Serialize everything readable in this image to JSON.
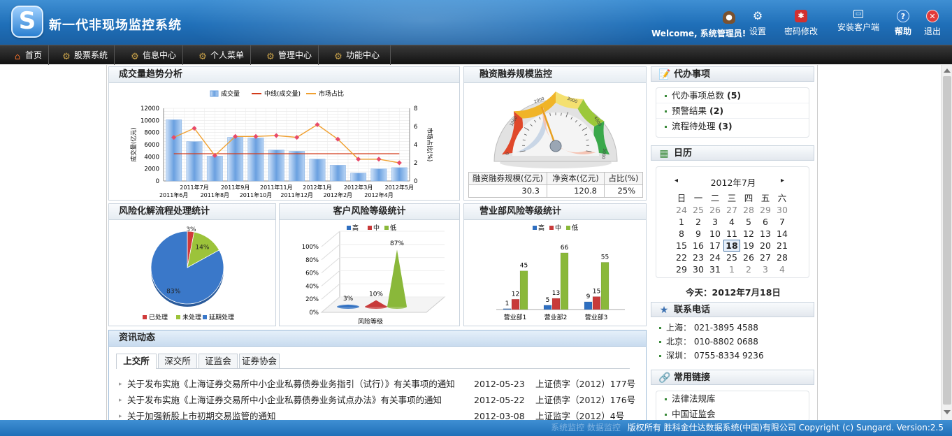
{
  "header": {
    "logo_letter": "S",
    "title": "新一代非现场监控系统",
    "welcome": "Welcome, 系统管理员!",
    "tools": [
      {
        "label": "设置",
        "icon": "gear-icon"
      },
      {
        "label": "密码修改",
        "icon": "key-icon"
      },
      {
        "label": "安装客户端",
        "icon": "install-icon"
      },
      {
        "label": "帮助",
        "icon": "help-icon"
      },
      {
        "label": "退出",
        "icon": "exit-icon"
      }
    ]
  },
  "menu": [
    {
      "label": "首页",
      "icon": "home-icon"
    },
    {
      "label": "股票系统",
      "icon": "gear-icon"
    },
    {
      "label": "信息中心",
      "icon": "gear-icon"
    },
    {
      "label": "个人菜单",
      "icon": "gear-icon"
    },
    {
      "label": "管理中心",
      "icon": "gear-icon"
    },
    {
      "label": "功能中心",
      "icon": "gear-icon"
    }
  ],
  "panels": {
    "trend": {
      "title": "成交量趋势分析"
    },
    "margin": {
      "title": "融资融券规模监控",
      "table_headers": [
        "融资融券规模(亿元)",
        "净资本(亿元)",
        "占比(%)"
      ],
      "table_values": [
        "30.3",
        "120.8",
        "25%"
      ]
    },
    "risk": {
      "title": "风险化解流程处理统计"
    },
    "customer_risk": {
      "title": "客户风险等级统计"
    },
    "branch_risk": {
      "title": "营业部风险等级统计"
    },
    "news": {
      "title": "资讯动态"
    }
  },
  "chart_data": [
    {
      "type": "bar",
      "title": "",
      "legend": [
        "成交量",
        "中线(成交量)",
        "市场占比"
      ],
      "ylabel": "成交量(亿元)",
      "y2label": "市场占比(%)",
      "ylim": [
        0,
        12000
      ],
      "y2lim": [
        0,
        8
      ],
      "categories": [
        "2011年6月",
        "2011年7月",
        "2011年8月",
        "2011年9月",
        "2011年10月",
        "2011年11月",
        "2011年12月",
        "2012年1月",
        "2012年2月",
        "2012年3月",
        "2012年4月",
        "2012年5月"
      ],
      "x_labels_top": [
        "2011年7月",
        "2011年9月",
        "2011年11月",
        "2012年1月",
        "2012年3月",
        "2012年5月"
      ],
      "x_labels_bottom": [
        "2011年6月",
        "2011年8月",
        "2011年10月",
        "2011年12月",
        "2012年2月",
        "2012年4月"
      ],
      "yticks": [
        "12000",
        "10000",
        "8000",
        "6000",
        "4000",
        "2000",
        "0"
      ],
      "y2ticks": [
        "8",
        "6",
        "4",
        "2",
        "0"
      ],
      "series": [
        {
          "name": "成交量",
          "values": [
            10100,
            6500,
            4100,
            7200,
            7100,
            5100,
            4900,
            3600,
            2600,
            1300,
            2000,
            2200
          ]
        },
        {
          "name": "中线(成交量)",
          "values": [
            4500,
            4500,
            4500,
            4500,
            4500,
            4500,
            4500,
            4500,
            4500,
            4500,
            4500,
            4500
          ]
        },
        {
          "name": "市场占比",
          "values": [
            4.8,
            5.8,
            2.8,
            4.9,
            4.9,
            5.0,
            4.8,
            6.2,
            4.6,
            2.4,
            2.4,
            2.0
          ]
        }
      ]
    },
    {
      "type": "gauge",
      "title": "",
      "min": 0,
      "max": 5000,
      "ticks": [
        "0",
        "1000",
        "2000",
        "3000",
        "4000",
        "5000"
      ],
      "value": 2000
    },
    {
      "type": "pie",
      "title": "",
      "legend": [
        "已处理",
        "未处理",
        "延期处理"
      ],
      "values": [
        3,
        14,
        83
      ],
      "labels": [
        "3%",
        "14%",
        "83%"
      ],
      "colors": [
        "#d03a3a",
        "#9cc33a",
        "#3a78c9"
      ]
    },
    {
      "type": "bar",
      "title": "",
      "legend": [
        "高",
        "中",
        "低"
      ],
      "xlabel": "风险等级",
      "yticks": [
        "100%",
        "80%",
        "60%",
        "40%",
        "20%",
        "0%"
      ],
      "values": [
        3,
        10,
        87
      ],
      "labels": [
        "3%",
        "10%",
        "87%"
      ],
      "colors": [
        "#2f6fc0",
        "#c83a3a",
        "#8ab83a"
      ]
    },
    {
      "type": "bar",
      "title": "",
      "legend": [
        "高",
        "中",
        "低"
      ],
      "categories": [
        "营业部1",
        "营业部2",
        "营业部3"
      ],
      "series": [
        {
          "name": "高",
          "values": [
            1,
            5,
            9
          ]
        },
        {
          "name": "中",
          "values": [
            12,
            13,
            15
          ]
        },
        {
          "name": "低",
          "values": [
            45,
            66,
            55
          ]
        }
      ]
    }
  ],
  "todo": {
    "title": "代办事项",
    "items": [
      {
        "label": "代办事项总数",
        "count": "(5)"
      },
      {
        "label": "预警结果",
        "count": "(2)"
      },
      {
        "label": "流程待处理",
        "count": "(3)"
      }
    ]
  },
  "calendar": {
    "title": "日历",
    "month": "2012年7月",
    "weekdays": [
      "日",
      "一",
      "二",
      "三",
      "四",
      "五",
      "六"
    ],
    "weeks": [
      [
        "24",
        "25",
        "26",
        "27",
        "28",
        "29",
        "30"
      ],
      [
        "1",
        "2",
        "3",
        "4",
        "5",
        "6",
        "7"
      ],
      [
        "8",
        "9",
        "10",
        "11",
        "12",
        "13",
        "14"
      ],
      [
        "15",
        "16",
        "17",
        "18",
        "19",
        "20",
        "21"
      ],
      [
        "22",
        "23",
        "24",
        "25",
        "26",
        "27",
        "28"
      ],
      [
        "29",
        "30",
        "31",
        "1",
        "2",
        "3",
        "4"
      ]
    ],
    "today_label": "今天：2012年7月18日"
  },
  "contacts": {
    "title": "联系电话",
    "items": [
      "上海：  021-3895 4588",
      "北京：  010-8802 0688",
      "深圳：  0755-8334 9236"
    ]
  },
  "links": {
    "title": "常用链接",
    "items": [
      "法律法规库",
      "中国证监会"
    ]
  },
  "news": {
    "tabs": [
      "上交所",
      "深交所",
      "证监会",
      "证券协会"
    ],
    "rows": [
      {
        "title": "关于发布实施《上海证券交易所中小企业私募债券业务指引（试行）》有关事项的通知",
        "date": "2012-05-23",
        "doc": "上证债字（2012）177号"
      },
      {
        "title": "关于发布实施《上海证券交易所中小企业私募债券业务试点办法》有关事项的通知",
        "date": "2012-05-22",
        "doc": "上证债字（2012）176号"
      },
      {
        "title": "关于加强新股上市初期交易监管的通知",
        "date": "2012-03-08",
        "doc": "上证监字（2012）4号"
      }
    ]
  },
  "status": {
    "faint": "系统监控  数据监控",
    "text": "版权所有 胜科金仕达数据系统(中国)有限公司 Copyright (c) Sungard. Version:2.5"
  }
}
